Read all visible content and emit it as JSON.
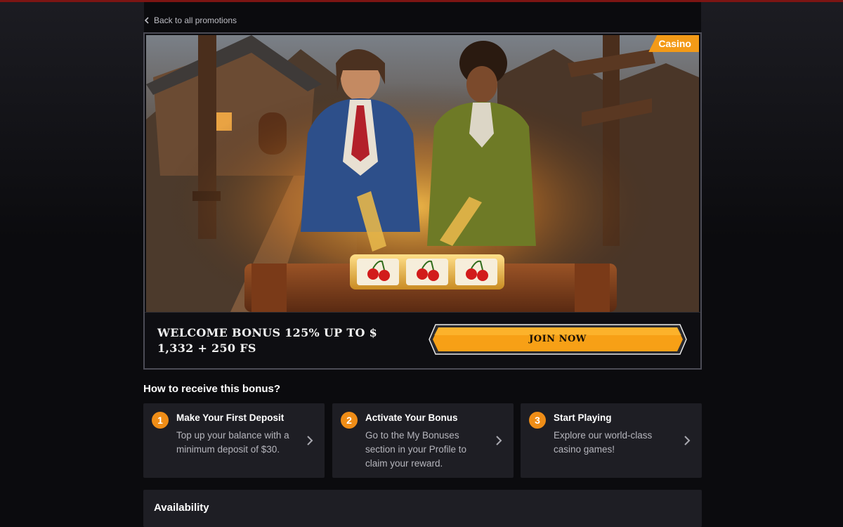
{
  "nav": {
    "back_label": "Back to all promotions"
  },
  "promo": {
    "badge": "Casino",
    "title": "WELCOME BONUS 125% UP TO $ 1,332 + 250 FS",
    "cta_label": "JOIN NOW",
    "hero_alt": "Two characters pulling levers of a cherry slot machine in a village"
  },
  "howto": {
    "title": "How to receive this bonus?",
    "steps": [
      {
        "number": "1",
        "title": "Make Your First Deposit",
        "description": "Top up your balance with a minimum deposit of $30."
      },
      {
        "number": "2",
        "title": "Activate Your Bonus",
        "description": "Go to the My Bonuses section in your Profile to claim your reward."
      },
      {
        "number": "3",
        "title": "Start Playing",
        "description": "Explore our world-class casino games!"
      }
    ]
  },
  "availability": {
    "title": "Availability"
  },
  "colors": {
    "accent": "#f39a17",
    "card_bg": "#1e1e24",
    "page_bg": "#0b0b0e",
    "top_line": "#7d1513"
  },
  "icons": {
    "back": "chevron-left-icon",
    "step_arrow": "chevron-right-icon"
  }
}
